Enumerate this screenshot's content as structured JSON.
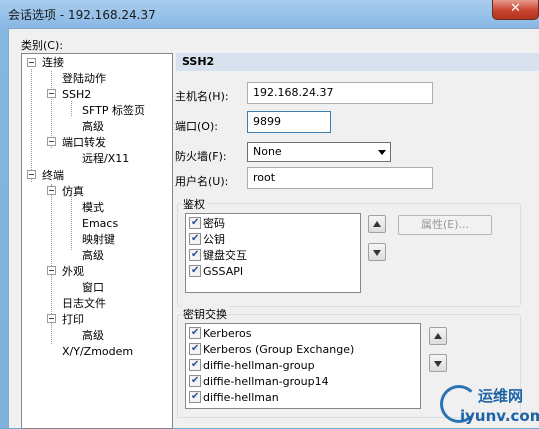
{
  "window": {
    "title": "会话选项 - 192.168.24.37",
    "close_glyph": "✕"
  },
  "category_label": "类别(C):",
  "tree": {
    "items": [
      "连接",
      "登陆动作",
      "SSH2",
      "SFTP 标签页",
      "高级",
      "端口转发",
      "远程/X11",
      "终端",
      "仿真",
      "模式",
      "Emacs",
      "映射键",
      "高级",
      "外观",
      "窗口",
      "日志文件",
      "打印",
      "高级",
      "X/Y/Zmodem"
    ]
  },
  "panel": {
    "header": "SSH2",
    "host_label": "主机名(H):",
    "host_value": "192.168.24.37",
    "port_label": "端口(O):",
    "port_value": "9899",
    "firewall_label": "防火墙(F):",
    "firewall_value": "None",
    "user_label": "用户名(U):",
    "user_value": "root",
    "auth": {
      "title": "鉴权",
      "items": [
        "密码",
        "公钥",
        "键盘交互",
        "GSSAPI"
      ],
      "props_button": "属性(E)..."
    },
    "kex": {
      "title": "密钥交换",
      "items": [
        "Kerberos",
        "Kerberos (Group Exchange)",
        "diffie-hellman-group",
        "diffie-hellman-group14",
        "diffie-hellman"
      ]
    }
  },
  "watermark": {
    "cn": "运维网",
    "en": "iyunv.com"
  }
}
